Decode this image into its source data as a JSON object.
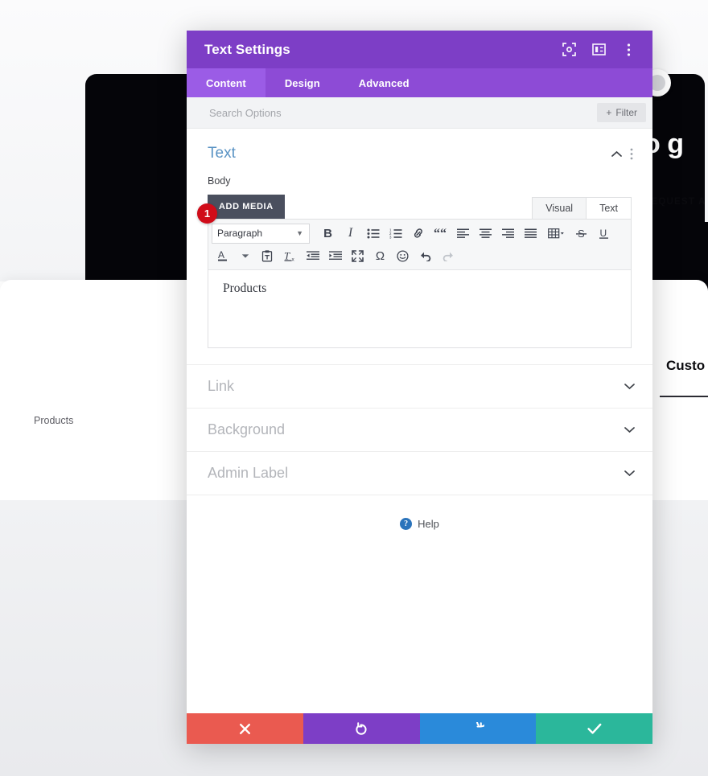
{
  "background_page": {
    "hero_heading_partial": "d to g",
    "request_button": "REQUEST A",
    "products_label": "Products",
    "custom_heading_partial": "Custo",
    "close_icon": "close-circle-icon"
  },
  "modal": {
    "title": "Text Settings",
    "titlebar_icons": [
      {
        "name": "focus-target-icon"
      },
      {
        "name": "panel-layout-icon"
      },
      {
        "name": "kebab-menu-icon"
      }
    ],
    "tabs": [
      {
        "label": "Content",
        "active": true
      },
      {
        "label": "Design",
        "active": false
      },
      {
        "label": "Advanced",
        "active": false
      }
    ],
    "search": {
      "placeholder": "Search Options",
      "value": "",
      "filter_label": "Filter",
      "filter_icon": "plus-icon"
    },
    "text_section": {
      "title": "Text",
      "collapse_icon": "chevron-up-icon",
      "options_icon": "kebab-menu-icon",
      "field_label": "Body",
      "add_media_label": "ADD MEDIA",
      "editor_tabs": [
        {
          "label": "Visual",
          "active": false
        },
        {
          "label": "Text",
          "active": true
        }
      ],
      "toolbar_row_1": [
        {
          "name": "format-select",
          "label": "Paragraph",
          "type": "select"
        },
        {
          "name": "bold-icon",
          "glyph": "B"
        },
        {
          "name": "italic-icon",
          "glyph": "I"
        },
        {
          "name": "bullet-list-icon"
        },
        {
          "name": "numbered-list-icon"
        },
        {
          "name": "link-icon"
        },
        {
          "name": "blockquote-icon"
        },
        {
          "name": "align-left-icon"
        },
        {
          "name": "align-center-icon"
        },
        {
          "name": "align-right-icon"
        },
        {
          "name": "align-justify-icon"
        },
        {
          "name": "table-icon"
        },
        {
          "name": "strikethrough-icon",
          "glyph": "S"
        },
        {
          "name": "underline-icon",
          "glyph": "U"
        }
      ],
      "toolbar_row_2": [
        {
          "name": "text-color-icon",
          "glyph": "A"
        },
        {
          "name": "text-color-dropdown-icon"
        },
        {
          "name": "paste-as-text-icon"
        },
        {
          "name": "clear-formatting-icon"
        },
        {
          "name": "outdent-icon"
        },
        {
          "name": "indent-icon"
        },
        {
          "name": "fullscreen-icon"
        },
        {
          "name": "special-character-icon",
          "glyph": "Ω"
        },
        {
          "name": "emoji-icon"
        },
        {
          "name": "undo-icon"
        },
        {
          "name": "redo-icon"
        }
      ],
      "body_content": "Products",
      "step_badge": "1"
    },
    "collapsed_sections": [
      {
        "label": "Link",
        "chevron": "chevron-down-icon"
      },
      {
        "label": "Background",
        "chevron": "chevron-down-icon"
      },
      {
        "label": "Admin Label",
        "chevron": "chevron-down-icon"
      }
    ],
    "help": {
      "label": "Help",
      "icon": "question-mark-icon"
    },
    "footer_buttons": [
      {
        "name": "cancel-button",
        "icon": "close-x-icon",
        "color": "#ea5a50"
      },
      {
        "name": "undo-button",
        "icon": "undo-arrow-icon",
        "color": "#7d3ec6"
      },
      {
        "name": "redo-button",
        "icon": "redo-arrow-icon",
        "color": "#2a8ada"
      },
      {
        "name": "save-button",
        "icon": "checkmark-icon",
        "color": "#2bb79b"
      }
    ]
  },
  "colors": {
    "titlebar_purple": "#7d3ec6",
    "tabbar_purple": "#8d4bd6",
    "tab_active_purple": "#9b5ce6",
    "section_title_blue": "#5a93c4",
    "badge_red": "#d00c19",
    "save_green": "#2bb79b"
  }
}
